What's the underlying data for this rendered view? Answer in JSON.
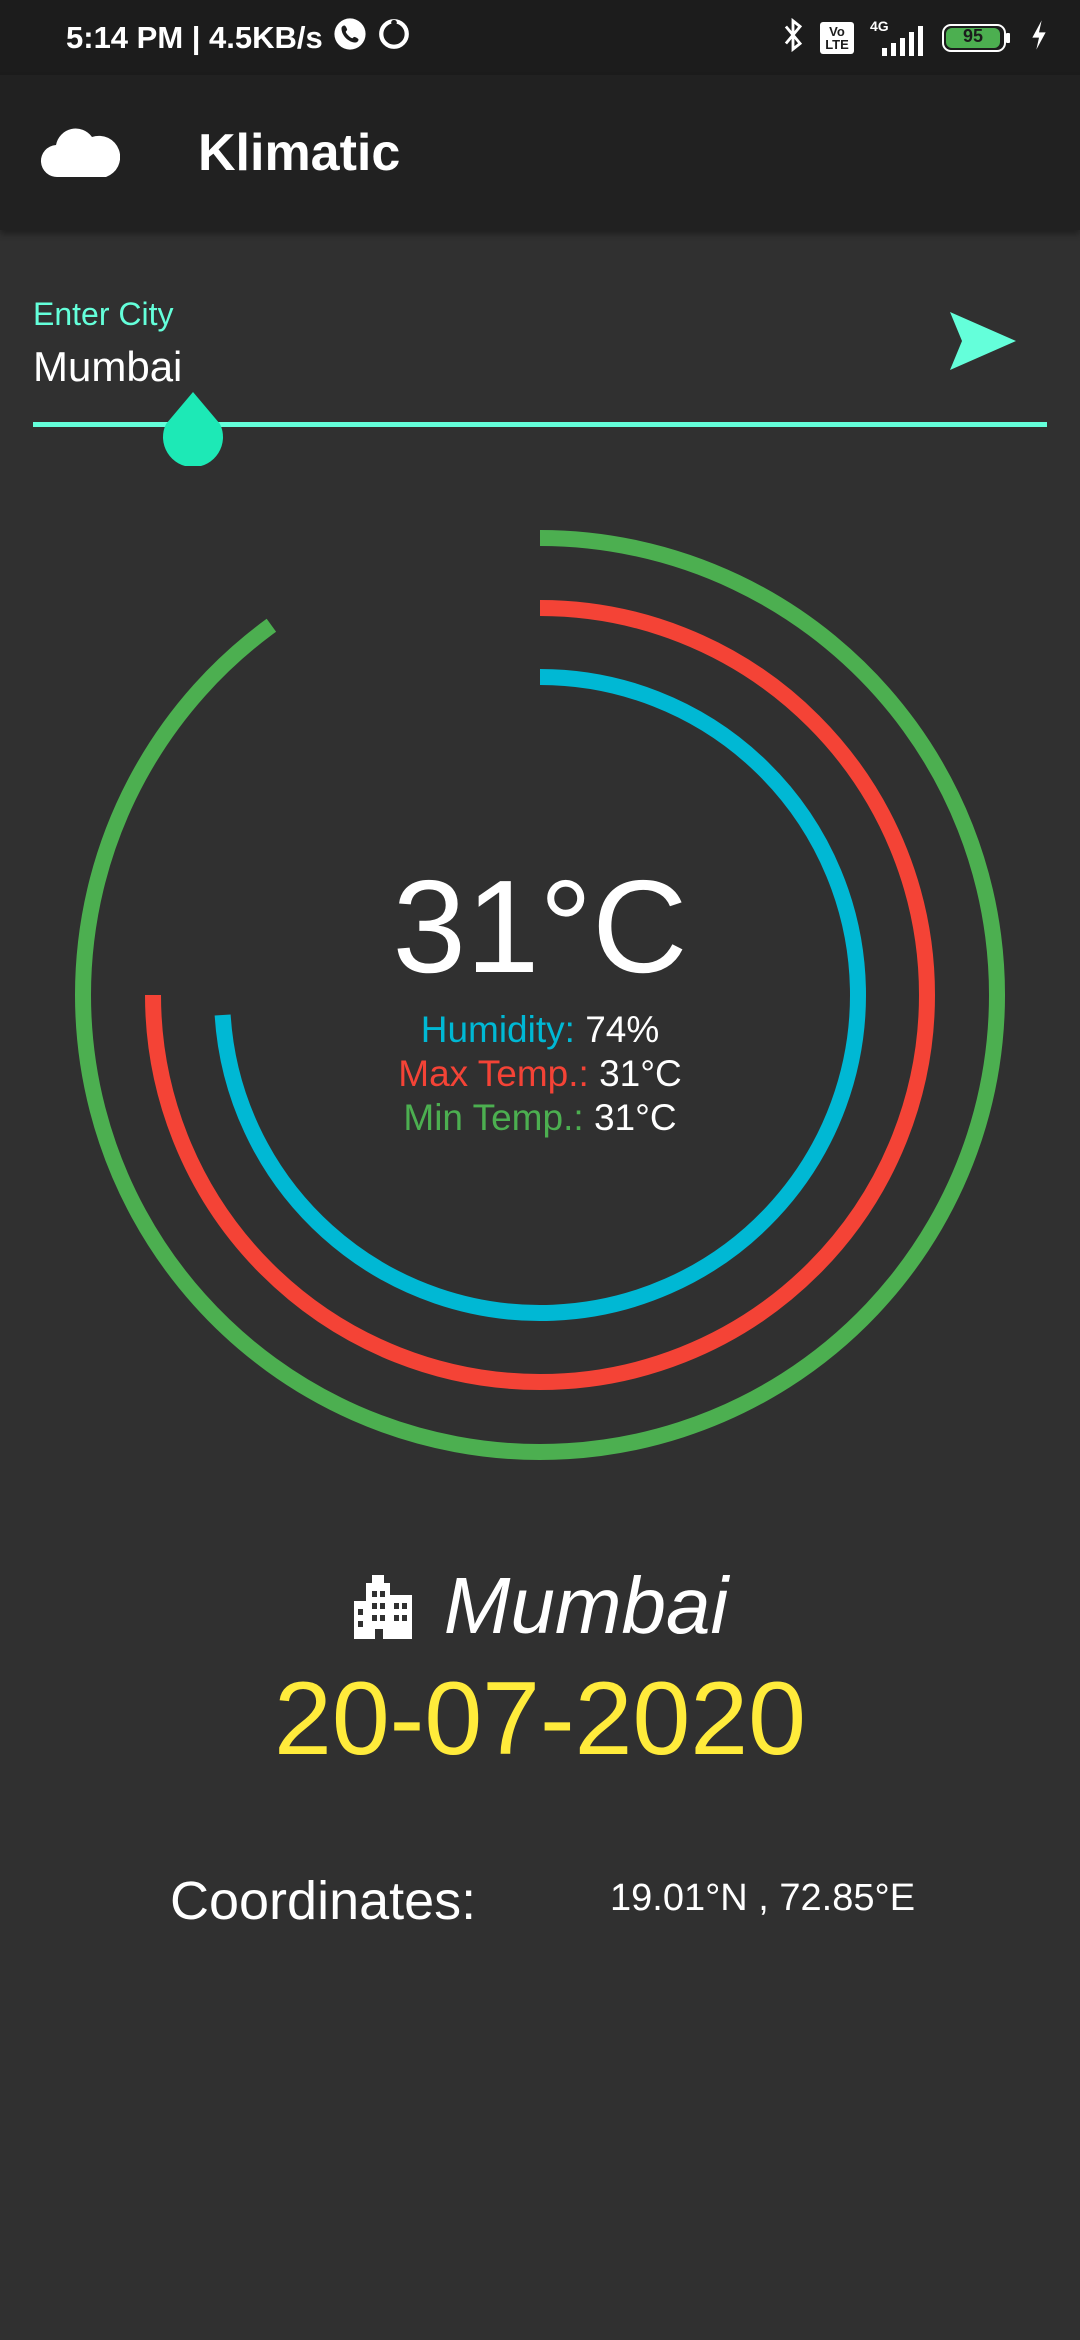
{
  "status_bar": {
    "time_speed": "5:14 PM | 4.5KB/s",
    "network": "4G",
    "volte": "Vo LTE",
    "battery": "95"
  },
  "app_bar": {
    "title": "Klimatic",
    "icon": "cloud-icon"
  },
  "search": {
    "label": "Enter City",
    "value": "Mumbai",
    "send_icon": "send-icon"
  },
  "weather": {
    "temperature": "31°C",
    "humidity_label": "Humidity:",
    "humidity_value": "74%",
    "max_label": "Max Temp.:",
    "max_value": "31°C",
    "min_label": "Min Temp.:",
    "min_value": "31°C",
    "rings": {
      "humidity_fraction": 0.74,
      "max_temp_fraction": 0.75,
      "min_temp_fraction": 0.9,
      "colors": {
        "humidity": "#00B8D4",
        "max_temp": "#F44336",
        "min_temp": "#4CAF50"
      }
    }
  },
  "location": {
    "city": "Mumbai",
    "city_icon": "building-icon",
    "date": "20-07-2020",
    "coordinates_label": "Coordinates:",
    "coordinates_value": "19.01°N , 72.85°E"
  },
  "colors": {
    "accent": "#64FFDA",
    "date": "#FFEB3B",
    "background": "#303030"
  }
}
